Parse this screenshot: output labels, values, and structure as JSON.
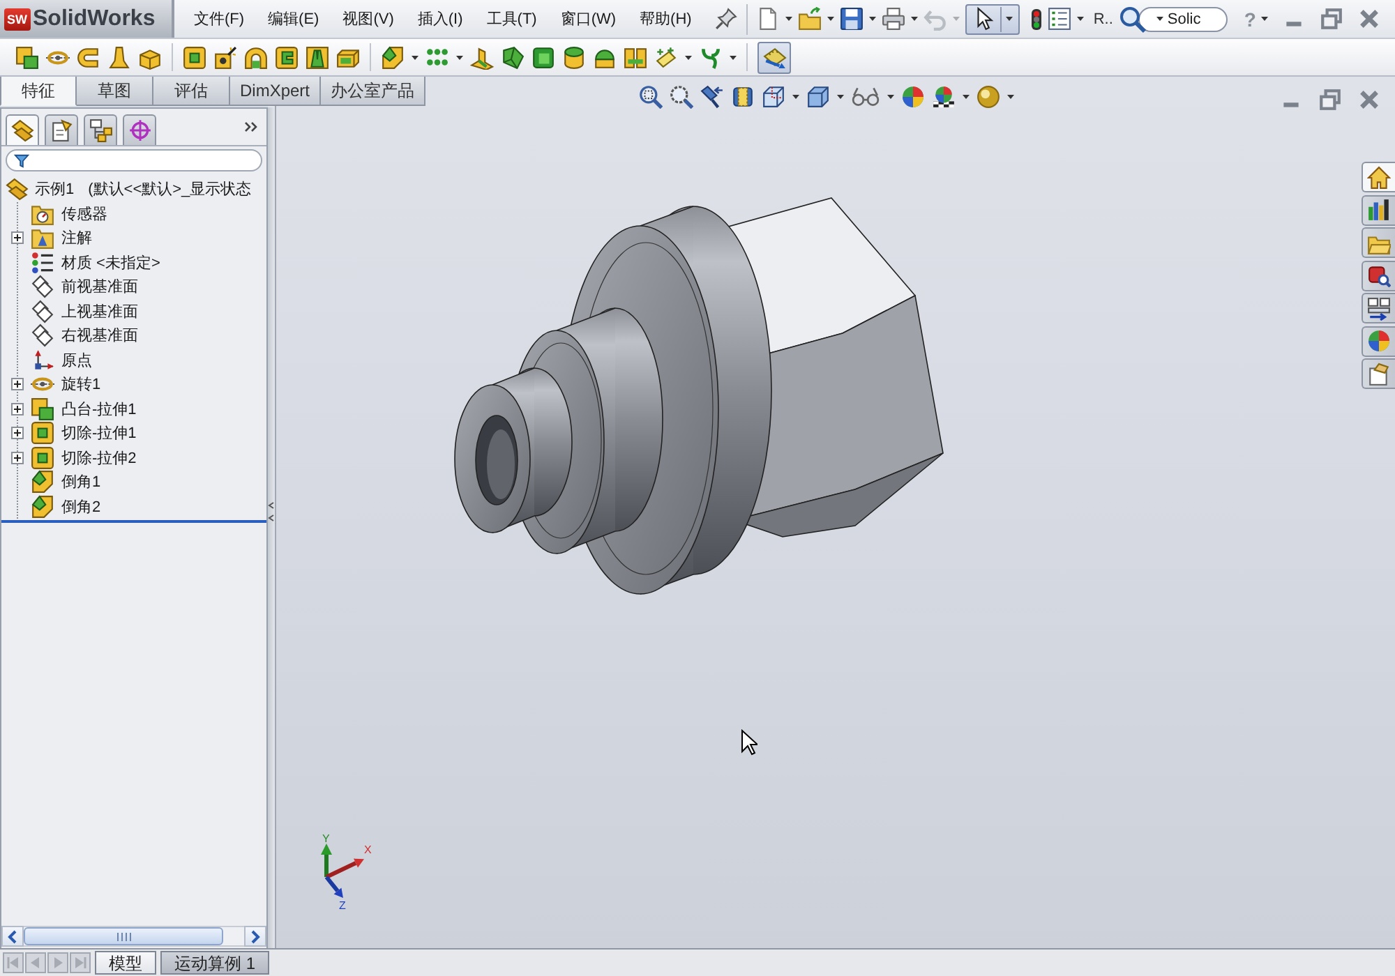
{
  "app": {
    "badge": "SW",
    "name": "SolidWorks"
  },
  "menu": [
    "文件(F)",
    "编辑(E)",
    "视图(V)",
    "插入(I)",
    "工具(T)",
    "窗口(W)",
    "帮助(H)"
  ],
  "quick_access": {
    "undo_disabled": true,
    "select_pressed": true,
    "label": "R..",
    "search": {
      "value": "Solic"
    },
    "help": "?"
  },
  "feature_toolbar": {
    "toggle_pressed": true
  },
  "command_tabs": [
    {
      "label": "特征",
      "selected": true
    },
    {
      "label": "草图",
      "selected": false
    },
    {
      "label": "评估",
      "selected": false
    },
    {
      "label": "DimXpert",
      "selected": false
    },
    {
      "label": "办公室产品",
      "selected": false
    }
  ],
  "manager_tabs": [
    {
      "selected": true
    },
    {
      "selected": false
    },
    {
      "selected": false
    },
    {
      "selected": false
    }
  ],
  "feature_tree": {
    "root": {
      "label": "示例1",
      "configuration": "(默认<<默认>_显示状态",
      "kind": "part"
    },
    "items": [
      {
        "label": "传感器",
        "kind": "sensor",
        "expandable": false
      },
      {
        "label": "注解",
        "kind": "annotation",
        "expandable": true
      },
      {
        "label": "材质 <未指定>",
        "kind": "material",
        "expandable": false
      },
      {
        "label": "前视基准面",
        "kind": "plane",
        "expandable": false
      },
      {
        "label": "上视基准面",
        "kind": "plane",
        "expandable": false
      },
      {
        "label": "右视基准面",
        "kind": "plane",
        "expandable": false
      },
      {
        "label": "原点",
        "kind": "origin",
        "expandable": false
      },
      {
        "label": "旋转1",
        "kind": "revolve",
        "expandable": true
      },
      {
        "label": "凸台-拉伸1",
        "kind": "boss",
        "expandable": true
      },
      {
        "label": "切除-拉伸1",
        "kind": "cut",
        "expandable": true
      },
      {
        "label": "切除-拉伸2",
        "kind": "cut",
        "expandable": true
      },
      {
        "label": "倒角1",
        "kind": "chamfer",
        "expandable": false
      },
      {
        "label": "倒角2",
        "kind": "chamfer",
        "expandable": false
      }
    ]
  },
  "triad_labels": [
    "Y",
    "X",
    "Z"
  ],
  "task_pane_tabs": [
    {
      "selected": true
    },
    {
      "selected": false
    },
    {
      "selected": false
    },
    {
      "selected": false
    },
    {
      "selected": false
    },
    {
      "selected": false
    },
    {
      "selected": false
    }
  ],
  "bottom_bar": {
    "nav_disabled": true,
    "tabs": [
      {
        "label": "模型",
        "selected": true
      },
      {
        "label": "运动算例 1",
        "selected": false
      }
    ]
  }
}
